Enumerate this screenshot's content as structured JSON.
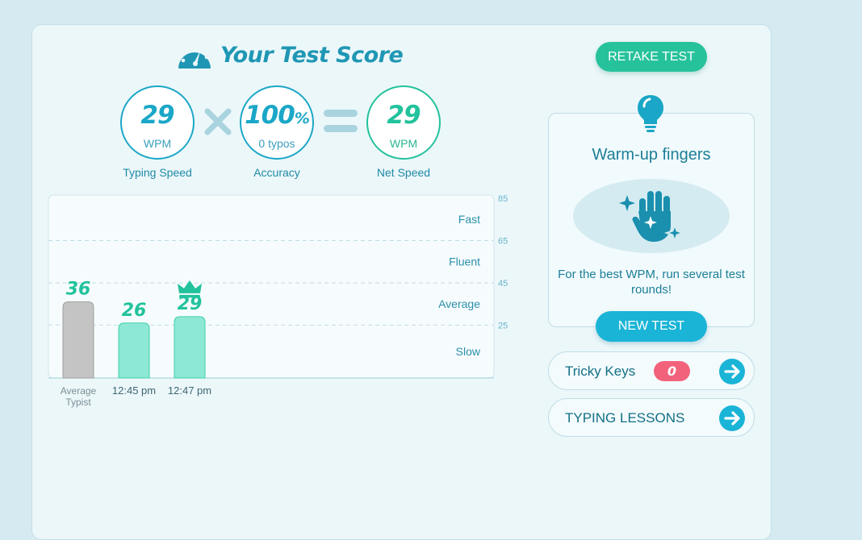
{
  "header": {
    "title": "Your Test Score",
    "icon": "speedometer-icon"
  },
  "metrics": {
    "speed": {
      "value": "29",
      "unit": "WPM",
      "caption": "Typing Speed",
      "color": "#1ba7c7"
    },
    "accuracy": {
      "value": "100",
      "symbol": "%",
      "unit": "0 typos",
      "caption": "Accuracy",
      "color": "#1ba7c7"
    },
    "net": {
      "value": "29",
      "unit": "WPM",
      "caption": "Net Speed",
      "color": "#22c29c"
    },
    "operators": {
      "multiply": "multiply-icon",
      "equals": "equals-icon"
    }
  },
  "chart_data": {
    "type": "bar",
    "categories": [
      "Average Typist",
      "12:45 pm",
      "12:47 pm"
    ],
    "values": [
      36,
      26,
      29
    ],
    "value_labels": [
      "36",
      "26",
      "29"
    ],
    "ylim": [
      0,
      85
    ],
    "yticks": [
      25,
      45,
      65,
      85
    ],
    "bands": [
      {
        "label": "Fast",
        "from": 65,
        "to": 85
      },
      {
        "label": "Fluent",
        "from": 45,
        "to": 65
      },
      {
        "label": "Average",
        "from": 25,
        "to": 45
      },
      {
        "label": "Slow",
        "from": 0,
        "to": 25
      }
    ],
    "best_index": 2,
    "grid": true,
    "colors": {
      "average": "#c4c4c4",
      "tests": "#8de8d5",
      "label": "#22c29c",
      "band_text": "#2b8fab",
      "tick": "#6bb6cb"
    }
  },
  "actions": {
    "retake_label": "RETAKE TEST",
    "new_test_label": "NEW TEST"
  },
  "tip": {
    "title": "Warm-up fingers",
    "text": "For the best WPM, run several test rounds!",
    "icons": [
      "lightbulb-icon",
      "hand-sparkle-icon"
    ]
  },
  "links": {
    "tricky_keys": {
      "label": "Tricky Keys",
      "count": "0"
    },
    "typing_lessons": {
      "label": "TYPING LESSONS"
    }
  },
  "colors": {
    "accent_blue": "#1ab4d6",
    "accent_green": "#26c29c",
    "badge_red": "#f2627a",
    "title_blue": "#1f97b4"
  }
}
